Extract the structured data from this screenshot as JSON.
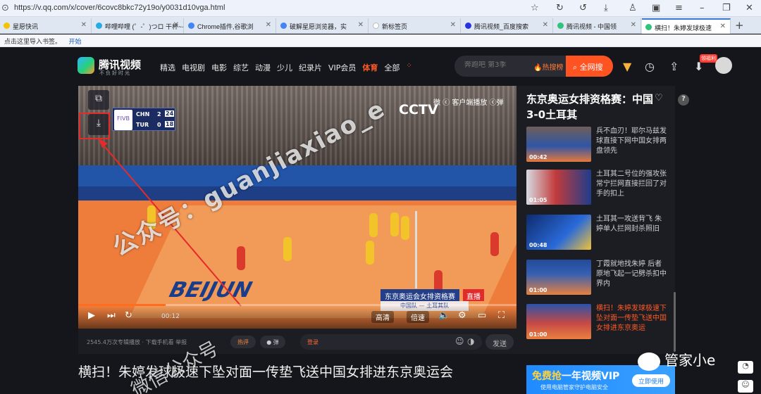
{
  "browser": {
    "url": "https://v.qq.com/x/cover/6covc8bkc72y19o/y0031d10vga.html",
    "tabs": [
      {
        "label": "星愿快讯",
        "color": "#f5c400"
      },
      {
        "label": "哔哩哔哩 (゜-゜)つロ 干杯~-bilibili",
        "color": "#23ade5"
      },
      {
        "label": "Chrome插件,谷歌浏",
        "color": "#4285f4"
      },
      {
        "label": "破解星愿浏览器，实",
        "color": "#4285f4"
      },
      {
        "label": "新标签页",
        "color": "#ffffff"
      },
      {
        "label": "腾讯视频_百度搜索",
        "color": "#2932e1"
      },
      {
        "label": "腾讯视频 - 中国领",
        "color": "#31c27c"
      },
      {
        "label": "横扫！朱婷发球极速",
        "color": "#31c27c"
      }
    ],
    "new_tab": "+",
    "bookmarks_prompt": "点击这里导入书签。",
    "bookmarks_start": "开始"
  },
  "header": {
    "logo_text": "腾讯视频",
    "slogan": "不负好时光",
    "nav": [
      "精选",
      "电视剧",
      "电影",
      "综艺",
      "动漫",
      "少儿",
      "纪录片",
      "VIP会员",
      "体育",
      "全部"
    ],
    "nav_active": "体育",
    "search_placeholder": "奔跑吧 第3季",
    "hot_search": "热搜榜",
    "search_button": "全网搜",
    "client_badge": "领福利"
  },
  "player": {
    "scoreboard": {
      "team1": "CHN",
      "sets1": "2",
      "pts1": "24",
      "team2": "TUR",
      "sets2": "0",
      "pts2": "18"
    },
    "channel": "CCTV",
    "top_right": "微 ⓒ 客户端播放 ⓒ弹",
    "caption_title": "东京奥运会女排资格赛",
    "caption_live": "直播",
    "caption_sub": "中国队 — 土耳其队",
    "floor_text": "BEIJUN",
    "time": "00:12",
    "progress": 0.2,
    "quality": "高清",
    "speed": "倍速"
  },
  "below_bar": {
    "views": "2545.4万次专辑播放 · 下载手机看 举报",
    "comment": "热评",
    "danmaku": "● 弹",
    "login": "登录",
    "send": "发送"
  },
  "video_title": "横扫！朱婷发球极速下坠对面一传垫飞送中国女排进东京奥运会",
  "right_panel": {
    "title": "东京奥运女排资格赛：中国3-0土耳其",
    "items": [
      {
        "text": "兵不血刃！耶尔马兹发球直接下网中国女排两盘领先",
        "duration": "00:42",
        "active": false
      },
      {
        "text": "土耳其二号位的强攻张常宁拦网直接拦回了对手的扣上",
        "duration": "01:05",
        "active": false
      },
      {
        "text": "土耳其一攻送背飞 朱婷单人拦网封杀照旧",
        "duration": "00:48",
        "active": false
      },
      {
        "text": "丁霞就地找朱婷 后者原地飞起一记劈杀扣中界内",
        "duration": "01:00",
        "active": false
      },
      {
        "text": "横扫！朱婷发球极速下坠对面一传垫飞送中国女排进东京奥运",
        "duration": "01:00",
        "active": true
      }
    ]
  },
  "vip_banner": {
    "line1_hl": "免费抢",
    "line1": "一年视频VIP",
    "line2": "使用电脑管家守护电脑安全",
    "button": "立即使用"
  },
  "watermark": "公众号：guanjiaxiao_e",
  "watermark2": "微信公众号",
  "wechat_mark": "管家小e",
  "colors": {
    "accent": "#ff5a26",
    "live_red": "#e32a2a",
    "vip_blue": "#1f8bff"
  }
}
